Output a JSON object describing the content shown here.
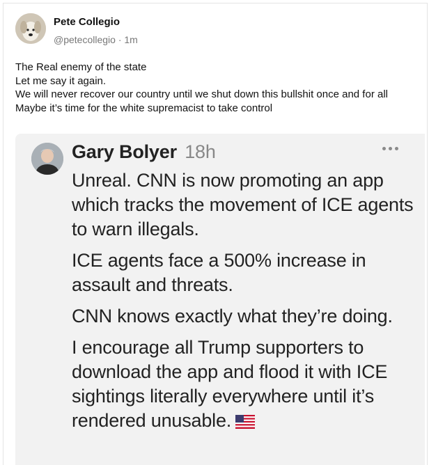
{
  "post": {
    "author": {
      "name": "Pete Collegio",
      "handle": "@petecollegio",
      "separator": "·",
      "time": "1m"
    },
    "body_lines": [
      "The Real enemy of the state",
      "Let me say it again.",
      "We will never recover our country until we shut down this bullshit once and for all",
      "Maybe it’s time for the white supremacist to take control"
    ]
  },
  "quoted": {
    "author": {
      "name": "Gary Bolyer",
      "time": "18h"
    },
    "more_icon": "ellipsis-icon",
    "paragraphs": [
      "Unreal. CNN is now promoting an app which tracks the movement of ICE agents to warn illegals.",
      "ICE agents face a 500% increase in assault and threats.",
      "CNN knows exactly what they’re doing.",
      "I encourage all Trump supporters to download the app and flood it with ICE sightings literally everywhere until it’s rendered unusable."
    ],
    "flag_icon": "us-flag-icon"
  },
  "colors": {
    "text": "#111111",
    "muted": "#777777",
    "quote_bg": "#f2f2f2"
  }
}
